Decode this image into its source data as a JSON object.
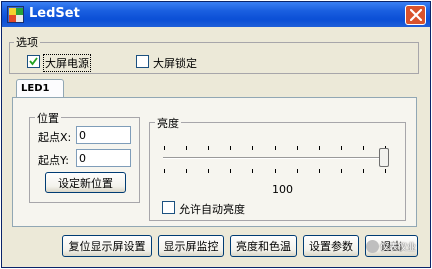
{
  "window": {
    "title": "LedSet"
  },
  "options": {
    "legend": "选项",
    "power": {
      "label": "大屏电源",
      "checked": true
    },
    "lock": {
      "label": "大屏锁定",
      "checked": false
    }
  },
  "tabs": [
    {
      "label": "LED1",
      "selected": true
    }
  ],
  "position": {
    "legend": "位置",
    "start_x_label": "起点X:",
    "start_x_value": "0",
    "start_y_label": "起点Y:",
    "start_y_value": "0",
    "set_button": "设定新位置"
  },
  "brightness": {
    "legend": "亮度",
    "value": "100",
    "level_fraction": 1.0,
    "auto": {
      "label": "允许自动亮度",
      "checked": false
    }
  },
  "buttons": {
    "reset_display": "复位显示屏设置",
    "monitor": "显示屏监控",
    "brightness_color": "亮度和色温",
    "settings": "设置参数",
    "exit": "退出"
  },
  "watermark": "仪表仪业"
}
